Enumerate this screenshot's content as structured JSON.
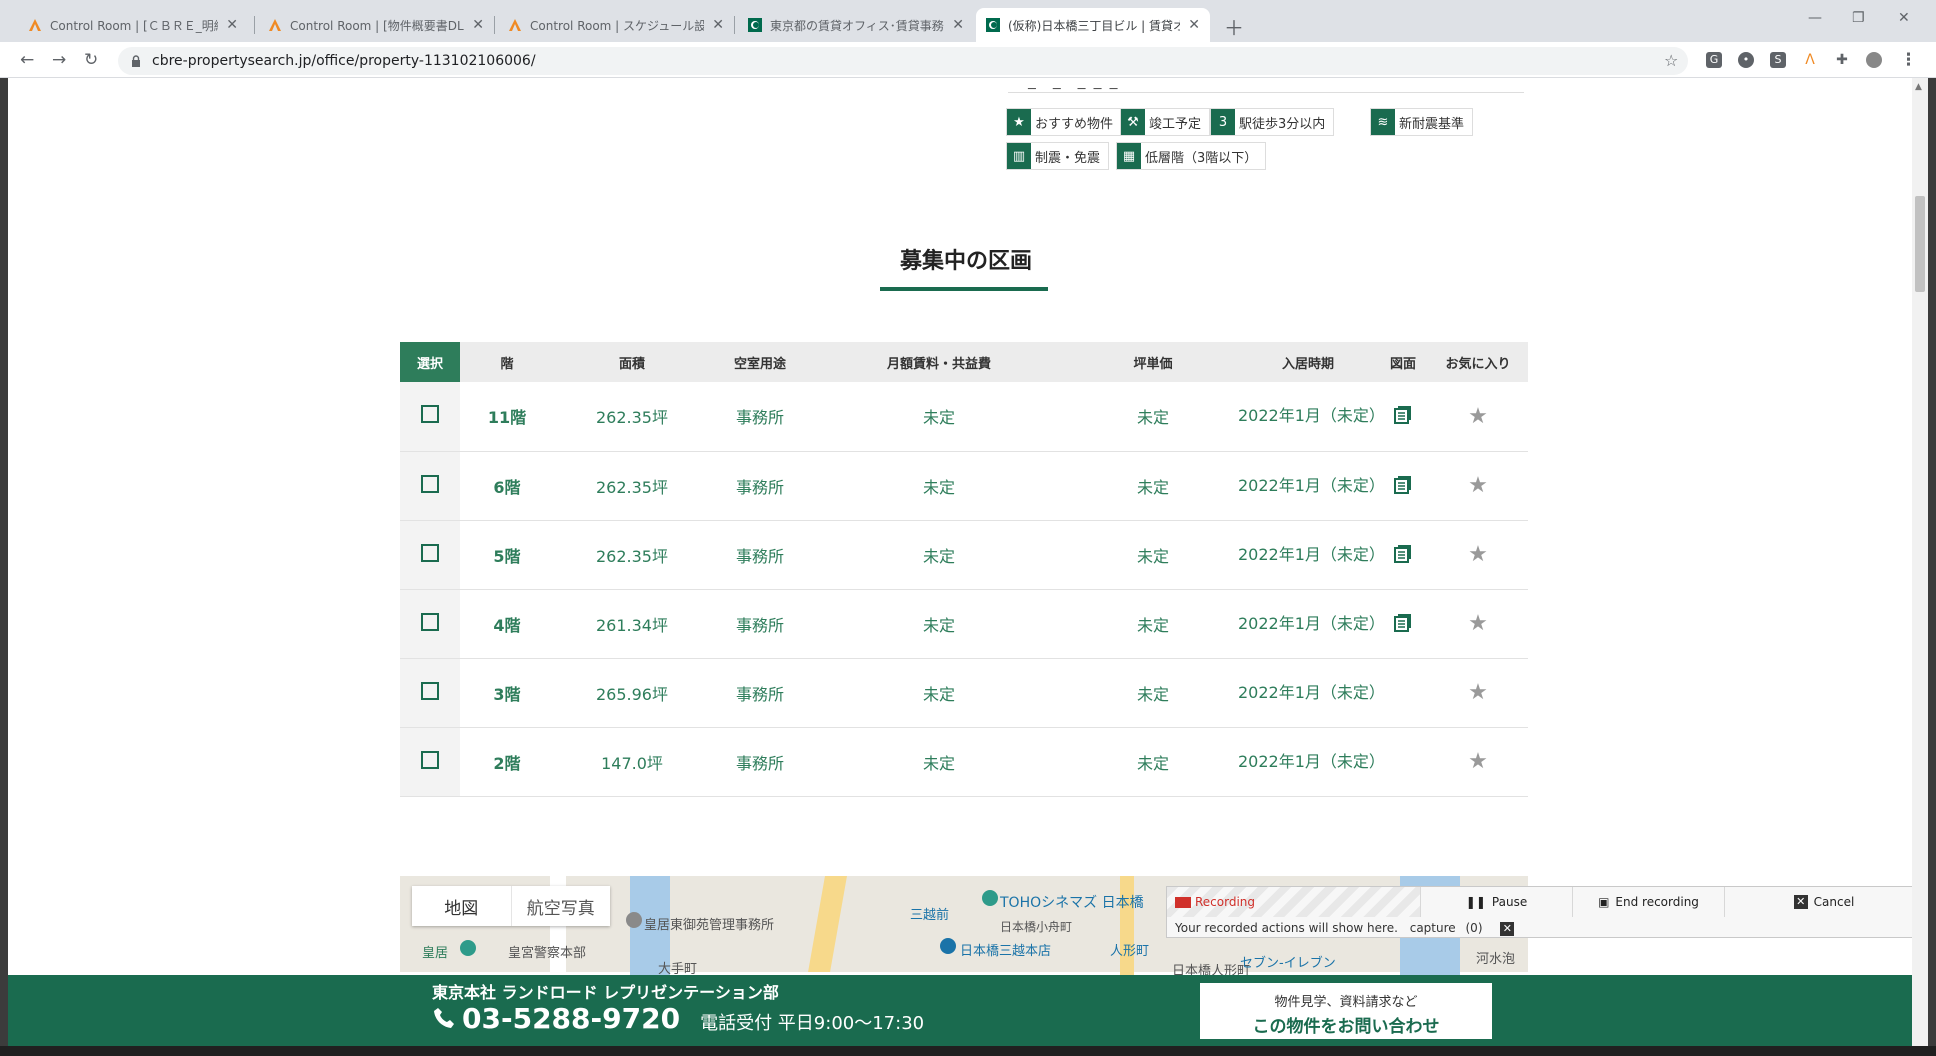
{
  "browser": {
    "tabs": [
      {
        "title": "Control Room | [ＣＢＲＥ_明細取",
        "favicon": "automation-anywhere-icon",
        "active": false
      },
      {
        "title": "Control Room | [物件概要書DL] T",
        "favicon": "automation-anywhere-icon",
        "active": false
      },
      {
        "title": "Control Room | スケジュール設定済",
        "favicon": "automation-anywhere-icon",
        "active": false
      },
      {
        "title": "東京都の賃貸オフィス･賃貸事務所",
        "favicon": "cbre-icon",
        "active": false
      },
      {
        "title": "(仮称)日本橋三丁目ビル | 賃貸オフ",
        "favicon": "cbre-icon",
        "active": true
      }
    ],
    "url": "cbre-propertysearch.jp/office/property-113102106006/"
  },
  "features": {
    "tags": [
      {
        "label": "おすすめ物件",
        "icon": "star-icon"
      },
      {
        "label": "竣工予定",
        "icon": "construction-icon"
      },
      {
        "label": "駅徒歩3分以内",
        "icon": "walk-3min-icon"
      },
      {
        "label": "新耐震基準",
        "icon": "quake-resistant-icon"
      },
      {
        "label": "制震・免震",
        "icon": "seismic-isolation-icon"
      },
      {
        "label": "低層階（3階以下）",
        "icon": "low-floor-icon"
      }
    ]
  },
  "section": {
    "title": "募集中の区画"
  },
  "table": {
    "headers": [
      "選択",
      "階",
      "面積",
      "空室用途",
      "月額賃料・共益費",
      "坪単価",
      "入居時期",
      "図面",
      "お気に入り"
    ],
    "rows": [
      {
        "floor": "11階",
        "area": "262.35坪",
        "use": "事務所",
        "rent": "未定",
        "unit_price": "未定",
        "move_in": "2022年1月（未定）",
        "has_plan": true
      },
      {
        "floor": "6階",
        "area": "262.35坪",
        "use": "事務所",
        "rent": "未定",
        "unit_price": "未定",
        "move_in": "2022年1月（未定）",
        "has_plan": true
      },
      {
        "floor": "5階",
        "area": "262.35坪",
        "use": "事務所",
        "rent": "未定",
        "unit_price": "未定",
        "move_in": "2022年1月（未定）",
        "has_plan": true
      },
      {
        "floor": "4階",
        "area": "261.34坪",
        "use": "事務所",
        "rent": "未定",
        "unit_price": "未定",
        "move_in": "2022年1月（未定）",
        "has_plan": true
      },
      {
        "floor": "3階",
        "area": "265.96坪",
        "use": "事務所",
        "rent": "未定",
        "unit_price": "未定",
        "move_in": "2022年1月（未定）",
        "has_plan": false
      },
      {
        "floor": "2階",
        "area": "147.0坪",
        "use": "事務所",
        "rent": "未定",
        "unit_price": "未定",
        "move_in": "2022年1月（未定）",
        "has_plan": false
      }
    ]
  },
  "map": {
    "tabs": [
      "地図",
      "航空写真"
    ],
    "labels": [
      "皇居東御苑管理事務所",
      "皇居",
      "皇宮警察本部",
      "大手町",
      "三越前",
      "TOHOシネマズ 日本橋",
      "日本橋小舟町",
      "日本橋三越本店",
      "人形町",
      "日本橋人形町",
      "セブン-イレブン",
      "河水泡"
    ]
  },
  "recorder": {
    "recording_label": "Recording",
    "pause_label": "Pause",
    "end_label": "End recording",
    "cancel_label": "Cancel",
    "message": "Your recorded actions will show here.",
    "capture_label": "capture",
    "capture_count": "(0)"
  },
  "footer": {
    "office": "東京本社 ランドロード レプリゼンテーション部",
    "phone": "03-5288-9720",
    "hours": "電話受付 平日9:00～17:30",
    "cta_sub": "物件見学、資料請求など",
    "cta_main": "この物件をお問い合わせ"
  },
  "colors": {
    "brand": "#1a6b4f",
    "accent_light": "#2e7d5b"
  }
}
